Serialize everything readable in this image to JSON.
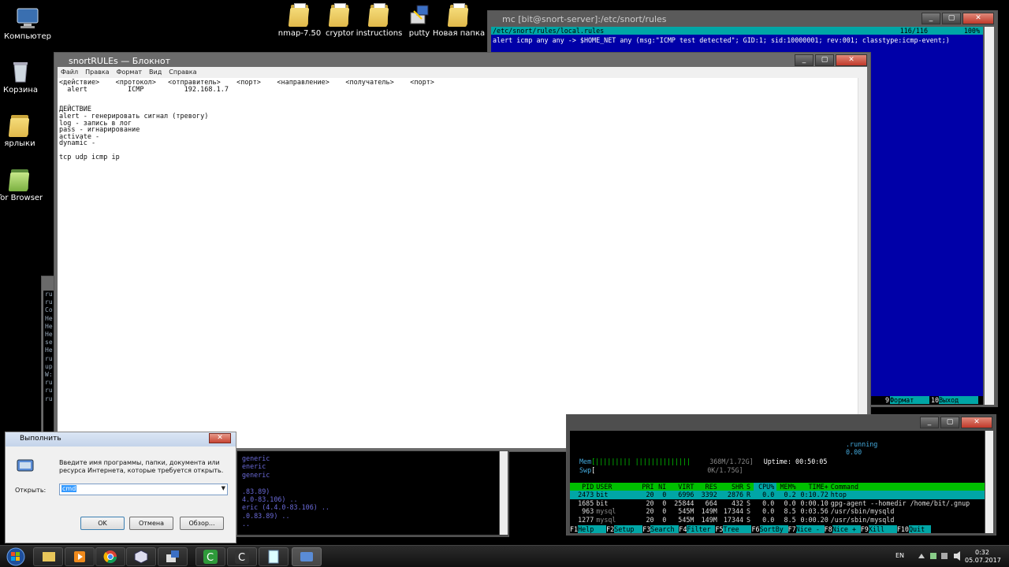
{
  "desktop": {
    "left_icons": [
      {
        "label": "Компьютер"
      },
      {
        "label": "Корзина"
      },
      {
        "label": "ярлыки"
      },
      {
        "label": "Tor Browser"
      }
    ],
    "top_icons": [
      {
        "label": "nmap-7.50"
      },
      {
        "label": "cryptor"
      },
      {
        "label": "instructions"
      },
      {
        "label": "putty"
      },
      {
        "label": "Новая папка"
      }
    ]
  },
  "mc_window": {
    "title": "mc [bit@snort-server]:/etc/snort/rules",
    "path": "/etc/snort/rules/local.rules",
    "position": "116/116",
    "percent": "100%",
    "rule_line": "alert icmp any any -> $HOME_NET any (msg:\"ICMP test detected\"; GID:1; sid:10000001; rev:001; classtype:icmp-event;)",
    "fkeys": [
      {
        "num": "9",
        "label": "Формат"
      },
      {
        "num": "10",
        "label": "Выход"
      }
    ]
  },
  "notepad": {
    "title": "snortRULEs — Блокнот",
    "menu": [
      "Файл",
      "Правка",
      "Формат",
      "Вид",
      "Справка"
    ],
    "lines": [
      "<действие>    <протокол>   <отправитель>    <порт>    <направление>    <получатель>    <порт>",
      "  alert          ICMP          192.168.1.7",
      "",
      "",
      "ДЕЙСТВИЕ",
      "alert - генерировать сигнал (тревогу)",
      "log - запись в лог",
      "pass - игнарирование",
      "activate -",
      "dynamic -",
      "",
      "tcp udp icmp ip"
    ]
  },
  "left_term_lines": [
    "ru",
    "ru",
    "Co",
    "He",
    "He",
    "He",
    "se",
    "He",
    "ru",
    "up",
    "W:",
    "ru",
    "ru",
    "ru"
  ],
  "bottom_left_term": {
    "lines": [
      "generic",
      "eneric",
      "generic",
      "",
      ".83.89)",
      "4.0-83.106) ..",
      "eric (4.4.0-83.106) ..",
      ".0.83.89) ..",
      ".."
    ]
  },
  "htop": {
    "top_right": [
      ".running",
      "  0.00"
    ],
    "mem_label": "Mem",
    "mem_bar": "[|||||||||  ||||||||||||||",
    "mem_value": "368M/1.72G]",
    "swp_label": "Swp",
    "swp_bar": "[",
    "swp_value": "0K/1.75G]",
    "uptime": "Uptime: 00:50:05",
    "header": [
      "PID",
      "USER",
      "PRI",
      "NI",
      "VIRT",
      "RES",
      "SHR",
      "S",
      "CPU%",
      "MEM%",
      "TIME+",
      "Command"
    ],
    "rows": [
      [
        "2473",
        "bit",
        "20",
        "0",
        "6996",
        "3392",
        "2876",
        "R",
        "0.0",
        "0.2",
        "0:10.72",
        "htop"
      ],
      [
        "1685",
        "bit",
        "20",
        "0",
        "25844",
        "664",
        "432",
        "S",
        "0.0",
        "0.0",
        "0:00.10",
        "gpg-agent --homedir /home/bit/.gnup"
      ],
      [
        "963",
        "mysql",
        "20",
        "0",
        "545M",
        "149M",
        "17344",
        "S",
        "0.0",
        "8.5",
        "0:03.56",
        "/usr/sbin/mysqld"
      ],
      [
        "1277",
        "mysql",
        "20",
        "0",
        "545M",
        "149M",
        "17344",
        "S",
        "0.0",
        "8.5",
        "0:00.20",
        "/usr/sbin/mysqld"
      ]
    ],
    "fkeys": [
      {
        "num": "F1",
        "label": "Help"
      },
      {
        "num": "F2",
        "label": "Setup"
      },
      {
        "num": "F3",
        "label": "Search"
      },
      {
        "num": "F4",
        "label": "Filter"
      },
      {
        "num": "F5",
        "label": "Tree"
      },
      {
        "num": "F6",
        "label": "SortBy"
      },
      {
        "num": "F7",
        "label": "Nice -"
      },
      {
        "num": "F8",
        "label": "Nice +"
      },
      {
        "num": "F9",
        "label": "Kill"
      },
      {
        "num": "F10",
        "label": "Quit"
      }
    ]
  },
  "run_dialog": {
    "title": "Выполнить",
    "description": "Введите имя программы, папки, документа или ресурса Интернета, которые требуется открыть.",
    "open_label": "Открыть:",
    "input_value": "cmd",
    "ok": "OK",
    "cancel": "Отмена",
    "browse": "Обзор..."
  },
  "taskbar": {
    "lang": "EN",
    "time": "0:32",
    "date": "05.07.2017"
  },
  "colors": {
    "mc_blue": "#0000a8",
    "mc_cyan": "#00a6a6",
    "htop_green": "#00c000",
    "htop_cyan": "#00a6a6"
  }
}
